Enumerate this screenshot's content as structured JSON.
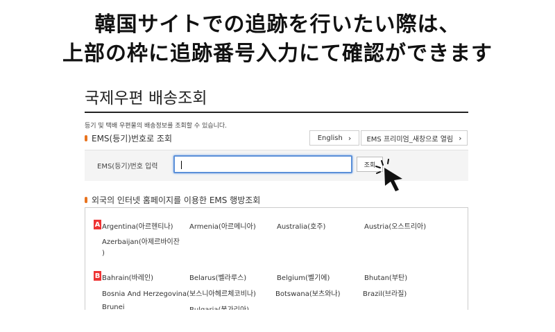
{
  "headline": {
    "line1": "韓国サイトでの追跡を行いたい際は、",
    "line2": "上部の枠に追跡番号入力にて確認ができます"
  },
  "page": {
    "title": "국제우편 배송조회",
    "description": "등기 및 택배 우편물의 배송정보를 조회할 수 있습니다."
  },
  "ems_section": {
    "title": "EMS(등기)번호로 조회",
    "english_link": "English",
    "premium_link": "EMS 프리미엄_새창으로 열림",
    "input_label": "EMS(등기)번호 입력",
    "input_value": "",
    "search_button": "조회"
  },
  "foreign_section": {
    "title": "외국의 인터넷 홈페이지를 이용한 EMS 행방조회",
    "groups": [
      {
        "letter": "A",
        "rows": [
          [
            "Argentina(아르헨티나)",
            "Armenia(아르메니아)",
            "Australia(호주)",
            "Austria(오스트리아)"
          ],
          [
            "Azerbaijan(아제르바이잔",
            ")"
          ]
        ]
      },
      {
        "letter": "B",
        "rows": [
          [
            "Bahrain(바레인)",
            "Belarus(벨라루스)",
            "Belgium(벨기에)",
            "Bhutan(부탄)"
          ],
          [
            "Bosnia And Herzegovina(보스니아헤르체코비나)",
            "Botswana(보츠와나)",
            "Brazil(브라질)"
          ],
          [
            "Brunei",
            "Bulgaria(불가리아)"
          ]
        ]
      }
    ]
  },
  "icons": {
    "chevron": "chevron-right-icon",
    "cursor": "hand-pointer-icon"
  },
  "colors": {
    "accent": "#e8731e",
    "letter_badge": "#ee3333",
    "focus": "#5a8fd8"
  }
}
